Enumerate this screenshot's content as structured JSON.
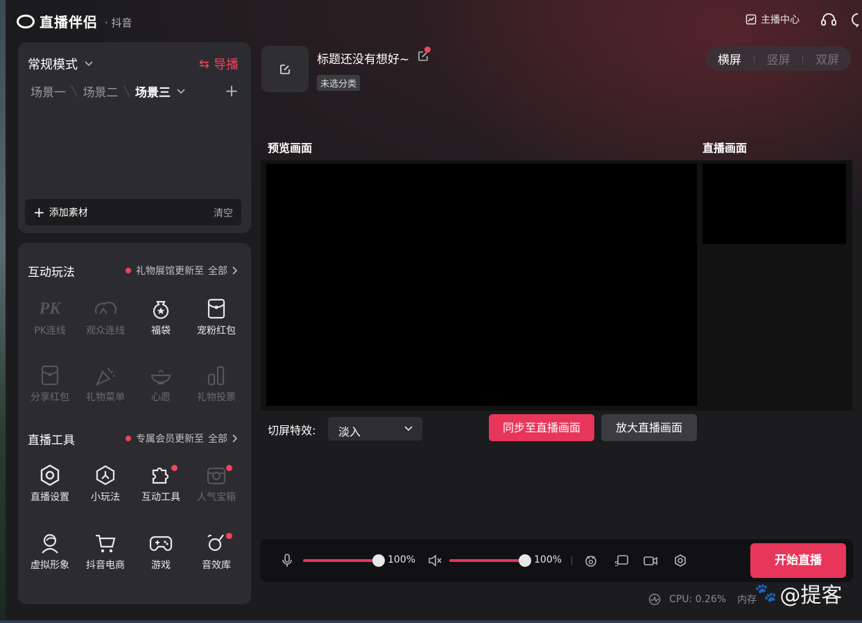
{
  "app": {
    "name": "直播伴侣",
    "platform": "· 抖音"
  },
  "titlebar": {
    "anchor_center": "主播中心"
  },
  "scene_panel": {
    "mode": "常规模式",
    "guide": "导播",
    "scenes": [
      "场景一",
      "场景二",
      "场景三"
    ],
    "active_scene": "场景三",
    "add_material": "添加素材",
    "clear": "清空"
  },
  "interactive": {
    "title": "互动玩法",
    "note": "礼物展馆更新至",
    "all": "全部",
    "items": [
      {
        "label": "PK连线",
        "icon": "pk-icon",
        "enabled": false
      },
      {
        "label": "观众连线",
        "icon": "audience-link-icon",
        "enabled": false
      },
      {
        "label": "福袋",
        "icon": "lucky-bag-icon",
        "enabled": true
      },
      {
        "label": "宠粉红包",
        "icon": "red-packet-icon",
        "enabled": true
      },
      {
        "label": "分享红包",
        "icon": "share-packet-icon",
        "enabled": false
      },
      {
        "label": "礼物菜单",
        "icon": "gift-menu-icon",
        "enabled": false
      },
      {
        "label": "心愿",
        "icon": "wish-icon",
        "enabled": false
      },
      {
        "label": "礼物投票",
        "icon": "gift-vote-icon",
        "enabled": false
      }
    ]
  },
  "live_tools": {
    "title": "直播工具",
    "note": "专属会员更新至",
    "all": "全部",
    "items": [
      {
        "label": "直播设置",
        "icon": "hex-settings-icon",
        "enabled": true
      },
      {
        "label": "小玩法",
        "icon": "mini-play-icon",
        "enabled": true
      },
      {
        "label": "互动工具",
        "icon": "puzzle-icon",
        "enabled": true
      },
      {
        "label": "人气宝箱",
        "icon": "treasure-box-icon",
        "enabled": false
      },
      {
        "label": "虚拟形象",
        "icon": "avatar-icon",
        "enabled": true
      },
      {
        "label": "抖音电商",
        "icon": "cart-icon",
        "enabled": true
      },
      {
        "label": "游戏",
        "icon": "gamepad-icon",
        "enabled": true
      },
      {
        "label": "音效库",
        "icon": "sound-library-icon",
        "enabled": true
      }
    ]
  },
  "header": {
    "stream_title": "标题还没有想好~",
    "category": "未选分类",
    "orientation": [
      "横屏",
      "竖屏",
      "双屏"
    ],
    "active_orientation": "横屏"
  },
  "stage": {
    "preview_label": "预览画面",
    "live_label": "直播画面",
    "transition_label": "切屏特效:",
    "transition_value": "淡入",
    "sync_button": "同步至直播画面",
    "zoom_button": "放大直播画面"
  },
  "controls": {
    "mic_volume": "100%",
    "speaker_volume": "100%",
    "mic_level": 1.0,
    "speaker_level": 1.0,
    "start_button": "开始直播"
  },
  "status": {
    "cpu": "CPU: 0.26%",
    "memory": "内存"
  },
  "watermark": "@提客",
  "colors": {
    "accent": "#e8365a",
    "badge": "#f0445f",
    "panel": "#2c2c30"
  }
}
